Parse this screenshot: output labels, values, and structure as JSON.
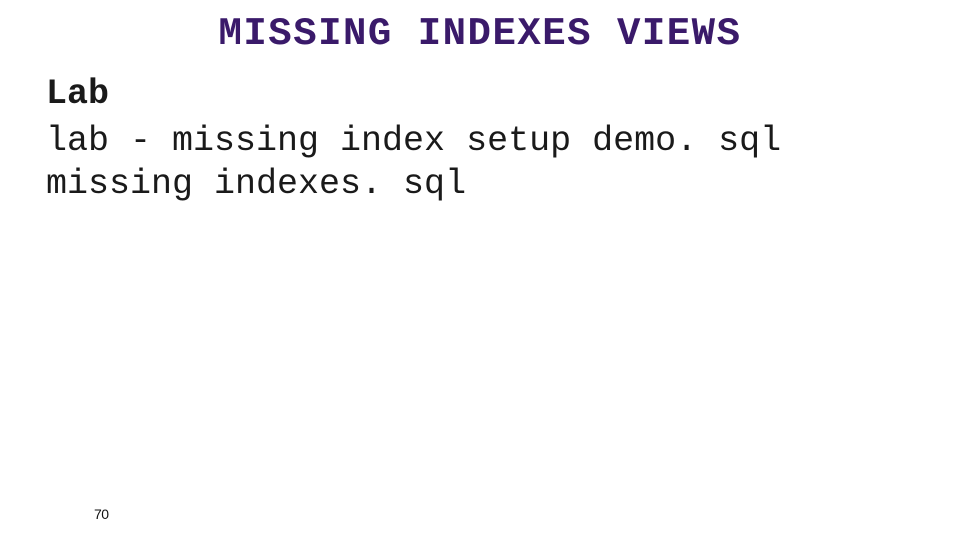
{
  "slide": {
    "title": "MISSING INDEXES VIEWS",
    "subheading": "Lab",
    "body_line_1": "lab - missing index setup demo. sql",
    "body_line_2": "missing indexes. sql",
    "page_number": "70"
  },
  "colors": {
    "title": "#3a1a6a",
    "text": "#1a1a1a",
    "background": "#ffffff"
  }
}
